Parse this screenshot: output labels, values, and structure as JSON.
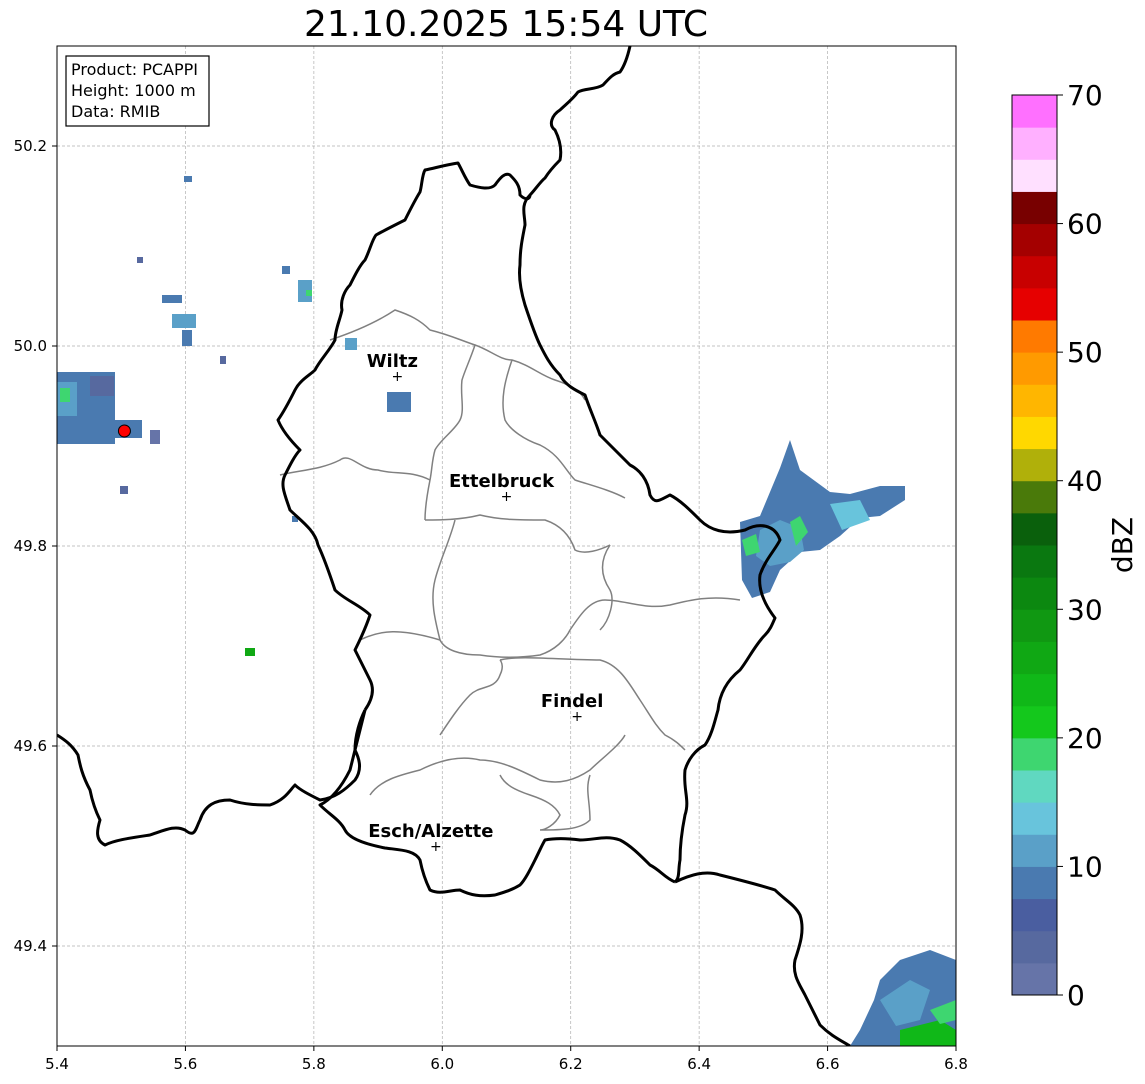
{
  "title": "21.10.2025 15:54 UTC",
  "info_box": {
    "product": "Product: PCAPPI",
    "height": "Height: 1000 m",
    "data": "Data: RMIB"
  },
  "map": {
    "lon_range": [
      5.4,
      6.8
    ],
    "lat_range": [
      49.3,
      50.3
    ],
    "x_ticks": [
      "5.4",
      "5.6",
      "5.8",
      "6.0",
      "6.2",
      "6.4",
      "6.6",
      "6.8"
    ],
    "y_ticks": [
      "49.4",
      "49.6",
      "49.8",
      "50.0",
      "50.2"
    ],
    "grid": true
  },
  "cities": [
    {
      "name": "Wiltz",
      "lon": 5.93,
      "lat": 49.97
    },
    {
      "name": "Ettelbruck",
      "lon": 6.1,
      "lat": 49.85
    },
    {
      "name": "Findel",
      "lon": 6.21,
      "lat": 49.63
    },
    {
      "name": "Esch/Alzette",
      "lon": 5.99,
      "lat": 49.5
    }
  ],
  "radar_site": {
    "lon": 5.505,
    "lat": 49.915,
    "color": "#ff0000"
  },
  "colorbar": {
    "label": "dBZ",
    "ticks": [
      "0",
      "10",
      "20",
      "30",
      "40",
      "50",
      "60",
      "70"
    ],
    "min": 0,
    "max": 70,
    "step": 2.5,
    "colors": [
      "#6674a8",
      "#57699f",
      "#4a5ea0",
      "#4a7ab0",
      "#5aa0c8",
      "#68c4dc",
      "#60d8c0",
      "#3ed670",
      "#14c81c",
      "#10b818",
      "#10a814",
      "#109812",
      "#0c8810",
      "#0a7810",
      "#0a600c",
      "#4a7a0a",
      "#b0b00a",
      "#ffd800",
      "#ffb600",
      "#ff9a00",
      "#ff7a00",
      "#e60000",
      "#c80000",
      "#a40000",
      "#780000",
      "#ffe0ff",
      "#ffb0ff",
      "#ff70ff",
      "#ee30ee"
    ]
  }
}
